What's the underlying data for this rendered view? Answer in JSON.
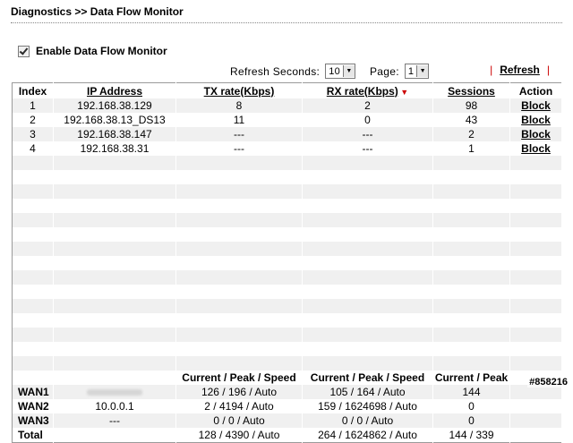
{
  "page": {
    "title": "Diagnostics >> Data Flow Monitor"
  },
  "enable": {
    "label": "Enable Data Flow Monitor",
    "checked": true
  },
  "controls": {
    "refresh_seconds_label": "Refresh Seconds:",
    "refresh_seconds_value": "10",
    "page_label": "Page:",
    "page_value": "1",
    "refresh_link": "Refresh",
    "separator": "|"
  },
  "table": {
    "headers": [
      "Index",
      "IP Address",
      "TX rate(Kbps)",
      "RX rate(Kbps)",
      "Sessions",
      "Action"
    ],
    "rows": [
      {
        "index": "1",
        "ip": "192.168.38.129",
        "tx": "8",
        "rx": "2",
        "sessions": "98",
        "action": "Block"
      },
      {
        "index": "2",
        "ip": "192.168.38.13_DS13",
        "tx": "11",
        "rx": "0",
        "sessions": "43",
        "action": "Block"
      },
      {
        "index": "3",
        "ip": "192.168.38.147",
        "tx": "---",
        "rx": "---",
        "sessions": "2",
        "action": "Block"
      },
      {
        "index": "4",
        "ip": "192.168.38.31",
        "tx": "---",
        "rx": "---",
        "sessions": "1",
        "action": "Block"
      }
    ]
  },
  "wan": {
    "headers": [
      "Current / Peak / Speed",
      "Current / Peak / Speed",
      "Current / Peak"
    ],
    "rows": [
      {
        "name": "WAN1",
        "ip": "",
        "tx": "126 / 196 / Auto",
        "rx": "105 / 164 / Auto",
        "sessions": "144"
      },
      {
        "name": "WAN2",
        "ip": "10.0.0.1",
        "tx": "2 / 4194 / Auto",
        "rx": "159 / 1624698 / Auto",
        "sessions": "0"
      },
      {
        "name": "WAN3",
        "ip": "---",
        "tx": "0 / 0 / Auto",
        "rx": "0 / 0 / Auto",
        "sessions": "0"
      },
      {
        "name": "Total",
        "ip": "",
        "tx": "128 / 4390 / Auto",
        "rx": "264 / 1624862 / Auto",
        "sessions": "144 / 339"
      }
    ]
  },
  "watermark": "#858216",
  "icons": {
    "checkbox": "checkmark-icon",
    "select_arrow": "triangle-down-icon",
    "sort": "sort-desc-icon"
  },
  "colors": {
    "row_stripe": "#f0f0f0",
    "sort_indicator": "#cc0000",
    "border": "#9a9a9a"
  }
}
